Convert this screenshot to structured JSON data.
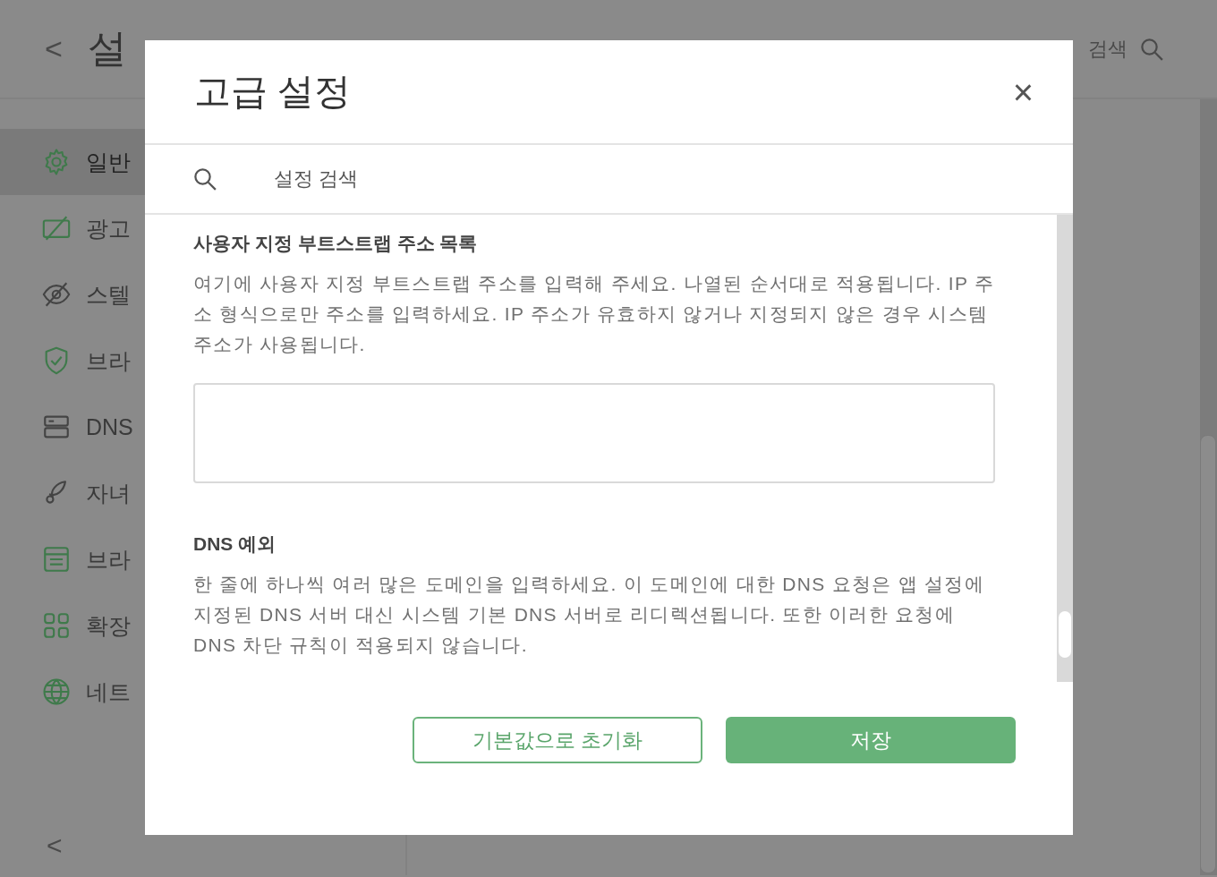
{
  "app": {
    "back_label": "<",
    "title": "설",
    "search_label": "검색"
  },
  "sidebar": {
    "items": [
      {
        "label": "일반",
        "selected": true
      },
      {
        "label": "광고",
        "selected": false
      },
      {
        "label": "스텔",
        "selected": false
      },
      {
        "label": "브라",
        "selected": false
      },
      {
        "label": "DNS",
        "selected": false
      },
      {
        "label": "자녀",
        "selected": false
      },
      {
        "label": "브라",
        "selected": false
      },
      {
        "label": "확장",
        "selected": false
      },
      {
        "label": "네트",
        "selected": false
      }
    ],
    "collapse_label": "<"
  },
  "dialog": {
    "title": "고급 설정",
    "close_label": "×",
    "search": {
      "placeholder": "설정 검색"
    },
    "sections": [
      {
        "title": "사용자 지정 부트스트랩 주소 목록",
        "description": "여기에 사용자 지정 부트스트랩 주소를 입력해 주세요. 나열된 순서대로 적용됩니다. IP 주소 형식으로만 주소를 입력하세요. IP 주소가 유효하지 않거나 지정되지 않은 경우 시스템 주소가 사용됩니다."
      },
      {
        "title": "DNS 예외",
        "description": "한 줄에 하나씩 여러 많은 도메인을 입력하세요. 이 도메인에 대한 DNS 요청은 앱 설정에 지정된 DNS 서버 대신 시스템 기본 DNS 서버로 리디렉션됩니다. 또한 이러한 요청에 DNS 차단 규칙이 적용되지 않습니다."
      }
    ],
    "buttons": [
      {
        "label": "기본값으로 초기화",
        "kind": "outline"
      },
      {
        "label": "저장",
        "kind": "primary"
      }
    ]
  }
}
